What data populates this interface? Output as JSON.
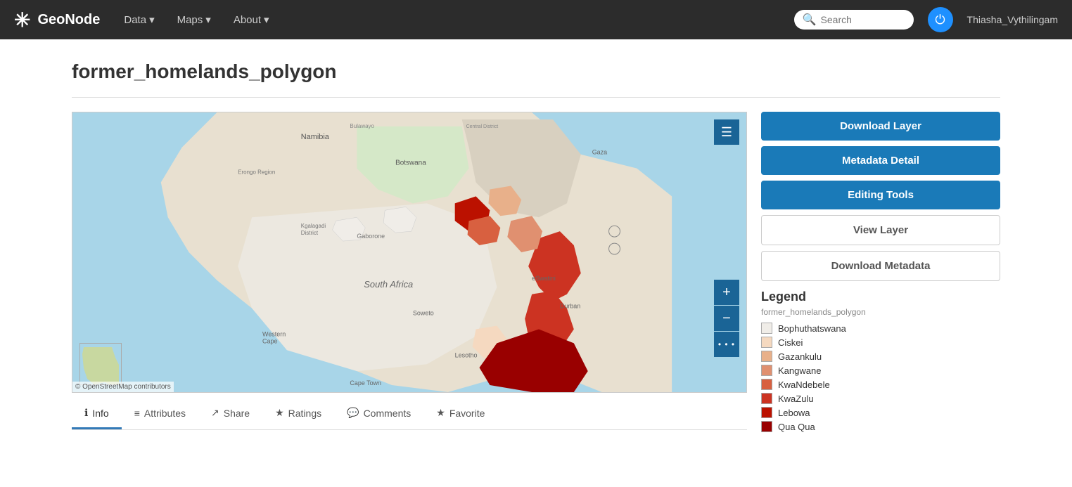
{
  "brand": {
    "name": "GeoNode",
    "icon": "✳"
  },
  "nav": {
    "items": [
      {
        "label": "Data",
        "has_dropdown": true
      },
      {
        "label": "Maps",
        "has_dropdown": true
      },
      {
        "label": "About",
        "has_dropdown": true
      }
    ]
  },
  "header": {
    "search_placeholder": "Search",
    "username": "Thiasha_Vythilingam",
    "user_icon_letter": "⏻"
  },
  "page": {
    "title": "former_homelands_polygon"
  },
  "sidebar": {
    "download_layer": "Download Layer",
    "metadata_detail": "Metadata Detail",
    "editing_tools": "Editing Tools",
    "view_layer": "View Layer",
    "download_metadata": "Download Metadata",
    "legend_title": "Legend",
    "legend_layer": "former_homelands_polygon",
    "legend_items": [
      {
        "label": "Bophuthatswana",
        "color": "#f0ede8"
      },
      {
        "label": "Ciskei",
        "color": "#f5d9c0"
      },
      {
        "label": "Gazankulu",
        "color": "#e8b08a"
      },
      {
        "label": "Kangwane",
        "color": "#e09070"
      },
      {
        "label": "KwaNdebele",
        "color": "#d86040"
      },
      {
        "label": "KwaZulu",
        "color": "#cc3322"
      },
      {
        "label": "Lebowa",
        "color": "#bb1100"
      },
      {
        "label": "Qua Qua",
        "color": "#990000"
      }
    ]
  },
  "tabs": [
    {
      "label": "Info",
      "icon": "ℹ",
      "active": true
    },
    {
      "label": "Attributes",
      "icon": "≡",
      "active": false
    },
    {
      "label": "Share",
      "icon": "↗",
      "active": false
    },
    {
      "label": "Ratings",
      "icon": "★",
      "active": false
    },
    {
      "label": "Comments",
      "icon": "💬",
      "active": false
    },
    {
      "label": "Favorite",
      "icon": "★",
      "active": false
    }
  ],
  "map": {
    "attribution": "© OpenStreetMap contributors"
  }
}
